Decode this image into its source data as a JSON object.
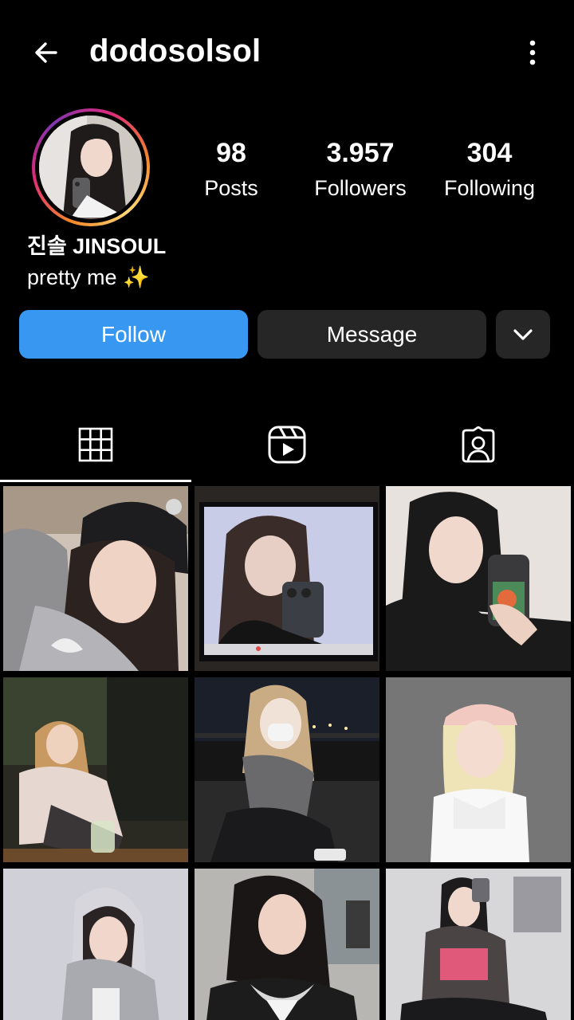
{
  "header": {
    "username": "dodosolsol",
    "back_icon": "arrow-left-icon",
    "more_icon": "more-vertical-icon"
  },
  "profile": {
    "display_name": "진솔 JINSOUL",
    "bio": "pretty me ✨",
    "stats": {
      "posts": {
        "value": "98",
        "label": "Posts"
      },
      "followers": {
        "value": "3.957",
        "label": "Followers"
      },
      "following": {
        "value": "304",
        "label": "Following"
      }
    }
  },
  "actions": {
    "follow_label": "Follow",
    "message_label": "Message",
    "suggest_icon": "chevron-down-icon"
  },
  "tabs": [
    {
      "name": "posts",
      "icon": "grid-icon",
      "active": true
    },
    {
      "name": "reels",
      "icon": "reels-icon",
      "active": false
    },
    {
      "name": "tagged",
      "icon": "tagged-person-icon",
      "active": false
    }
  ],
  "colors": {
    "follow_button": "#3897f0",
    "secondary_button": "#262626",
    "background": "#000000"
  },
  "grid_posts": [
    {
      "id": 1,
      "alt": "selfie with beanie"
    },
    {
      "id": 2,
      "alt": "mirror selfie on screen"
    },
    {
      "id": 3,
      "alt": "selfie with phone"
    },
    {
      "id": 4,
      "alt": "sitting in cafe"
    },
    {
      "id": 5,
      "alt": "sitting outdoors at night"
    },
    {
      "id": 6,
      "alt": "cap and white top"
    },
    {
      "id": 7,
      "alt": "hoodie portrait"
    },
    {
      "id": 8,
      "alt": "street portrait"
    },
    {
      "id": 9,
      "alt": "mirror selfie sitting"
    }
  ]
}
